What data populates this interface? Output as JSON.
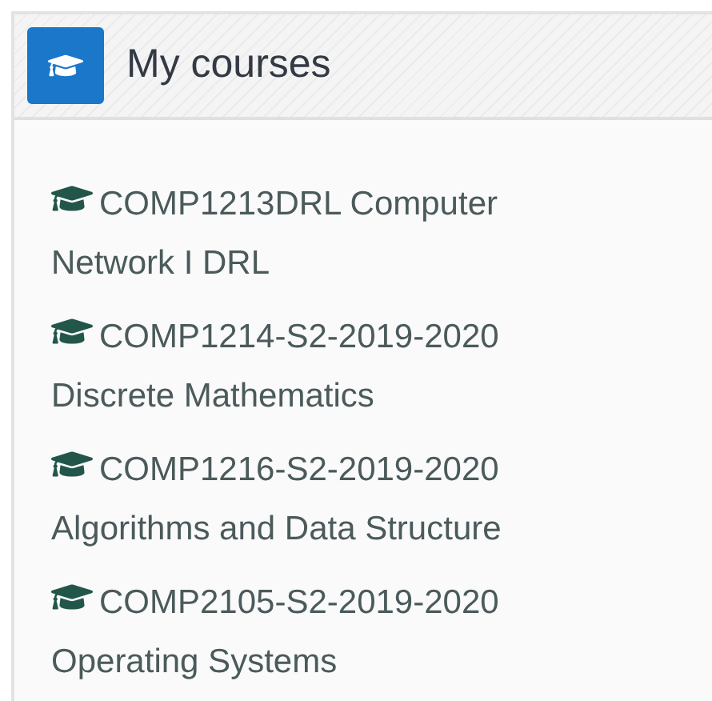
{
  "block": {
    "title": "My courses"
  },
  "courses": [
    {
      "label": "COMP1213DRL Computer Network I DRL"
    },
    {
      "label": "COMP1214-S2-2019-2020 Discrete Mathematics"
    },
    {
      "label": "COMP1216-S2-2019-2020 Algorithms and Data Structure"
    },
    {
      "label": "COMP2105-S2-2019-2020 Operating Systems"
    }
  ]
}
